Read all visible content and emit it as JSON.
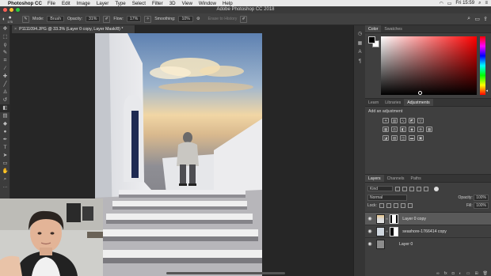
{
  "menubar": {
    "app": "Photoshop CC",
    "items": [
      "File",
      "Edit",
      "Image",
      "Layer",
      "Type",
      "Select",
      "Filter",
      "3D",
      "View",
      "Window",
      "Help"
    ],
    "time": "Fri 15:59"
  },
  "window": {
    "title": "Adobe Photoshop CC 2018"
  },
  "options": {
    "brush_size": "175",
    "mode_label": "Mode:",
    "mode_value": "Brush",
    "opacity_label": "Opacity:",
    "opacity_value": "31%",
    "flow_label": "Flow:",
    "flow_value": "17%",
    "smoothing_label": "Smoothing:",
    "smoothing_value": "10%",
    "erase_history": "Erase to History"
  },
  "document": {
    "tab_title": "P1111094.JPG @ 33.3% (Layer 0 copy, Layer Mask/8) *"
  },
  "color_panel": {
    "tabs": [
      "Color",
      "Swatches"
    ],
    "active_tab": "Color",
    "hue_color": "#ff0000"
  },
  "adjustments_panel": {
    "tabs": [
      "Learn",
      "Libraries",
      "Adjustments"
    ],
    "active_tab": "Adjustments",
    "title": "Add an adjustment"
  },
  "layers_panel": {
    "tabs": [
      "Layers",
      "Channels",
      "Paths"
    ],
    "active_tab": "Layers",
    "filter_kind": "Kind",
    "blend_mode": "Normal",
    "opacity_label": "Opacity:",
    "opacity_value": "100%",
    "lock_label": "Lock:",
    "fill_label": "Fill:",
    "fill_value": "100%",
    "layers": [
      {
        "name": "Layer 0 copy",
        "selected": true,
        "has_mask": true
      },
      {
        "name": "seashore-1766414 copy",
        "selected": false,
        "has_mask": true
      },
      {
        "name": "Layer 0",
        "selected": false,
        "has_mask": false
      }
    ]
  },
  "tools": [
    "move-tool",
    "marquee-tool",
    "lasso-tool",
    "quick-select-tool",
    "crop-tool",
    "eyedropper-tool",
    "healing-brush-tool",
    "brush-tool",
    "clone-stamp-tool",
    "history-brush-tool",
    "eraser-tool",
    "gradient-tool",
    "blur-tool",
    "dodge-tool",
    "pen-tool",
    "type-tool",
    "path-select-tool",
    "rectangle-tool",
    "hand-tool",
    "zoom-tool"
  ]
}
